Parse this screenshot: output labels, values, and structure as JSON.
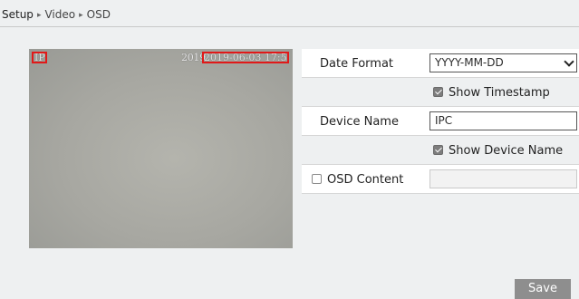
{
  "breadcrumb": {
    "items": [
      "Setup",
      "Video",
      "OSD"
    ],
    "separator": "▸"
  },
  "preview": {
    "osd_device_name": "IPC",
    "osd_timestamp_full": "2019-06-03 17:56:50",
    "osd_timestamp_visible_lead": "2019"
  },
  "form": {
    "date_format": {
      "label": "Date Format",
      "value": "YYYY-MM-DD"
    },
    "show_timestamp": {
      "label": "Show Timestamp",
      "checked": true
    },
    "device_name": {
      "label": "Device Name",
      "value": "IPC"
    },
    "show_device_name": {
      "label": "Show Device Name",
      "checked": true
    },
    "osd_content": {
      "label": "OSD Content",
      "checked": false,
      "value": ""
    }
  },
  "actions": {
    "save_label": "Save"
  },
  "colors": {
    "osd_box": "#e11919",
    "save_button": "#8e8e8e",
    "page_bg": "#eef0f1"
  }
}
